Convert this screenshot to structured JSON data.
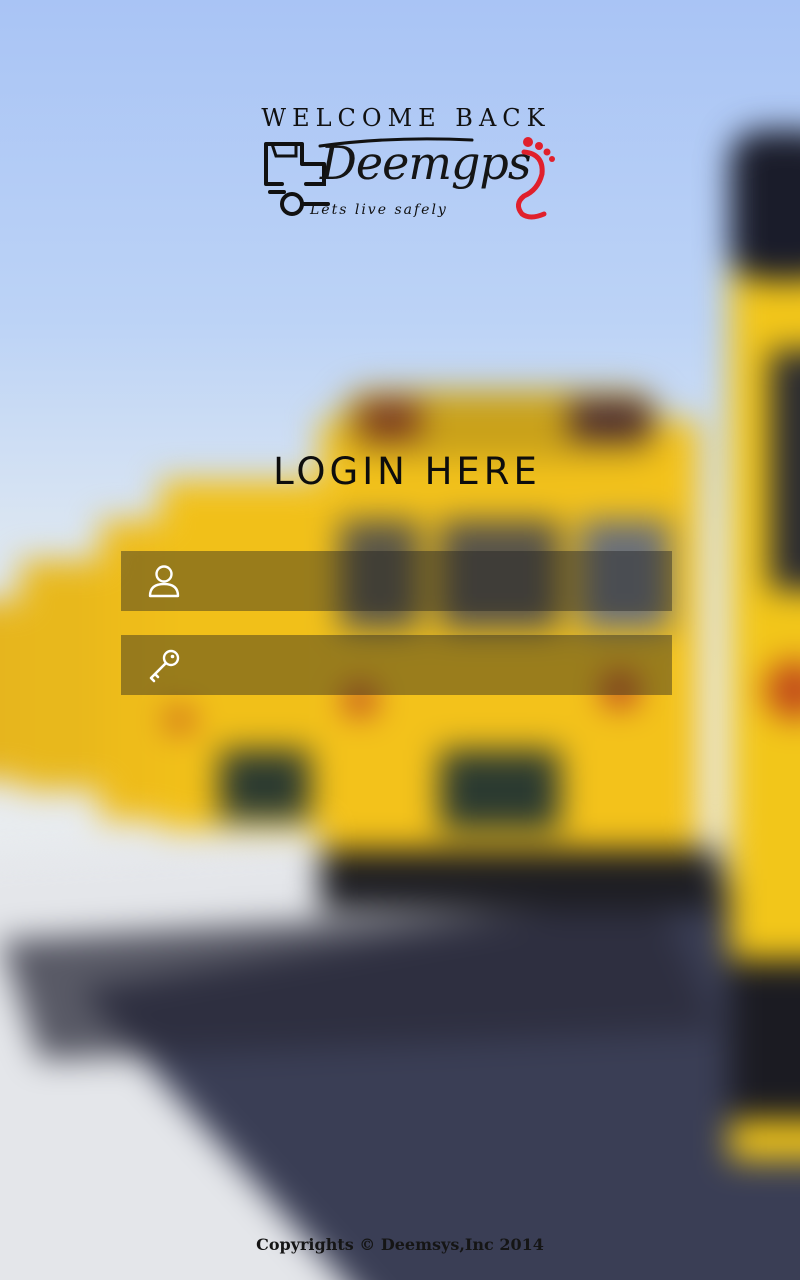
{
  "header": {
    "welcome_text": "WELCOME BACK",
    "logo": {
      "brand_text": "Deemgps",
      "tagline": "Lets live safely",
      "icon": "vehicle-footprint-logo",
      "accent_color": "#e0202c"
    }
  },
  "login": {
    "title": "LOGIN HERE",
    "username": {
      "icon": "user-icon",
      "value": "",
      "placeholder": ""
    },
    "password": {
      "icon": "key-icon",
      "value": "",
      "placeholder": ""
    }
  },
  "footer": {
    "copyright": "Copyrights © Deemsys,Inc 2014"
  },
  "colors": {
    "field_background": "rgba(30,30,30,0.42)",
    "icon_color": "#ffffff",
    "text_color": "#111111"
  }
}
